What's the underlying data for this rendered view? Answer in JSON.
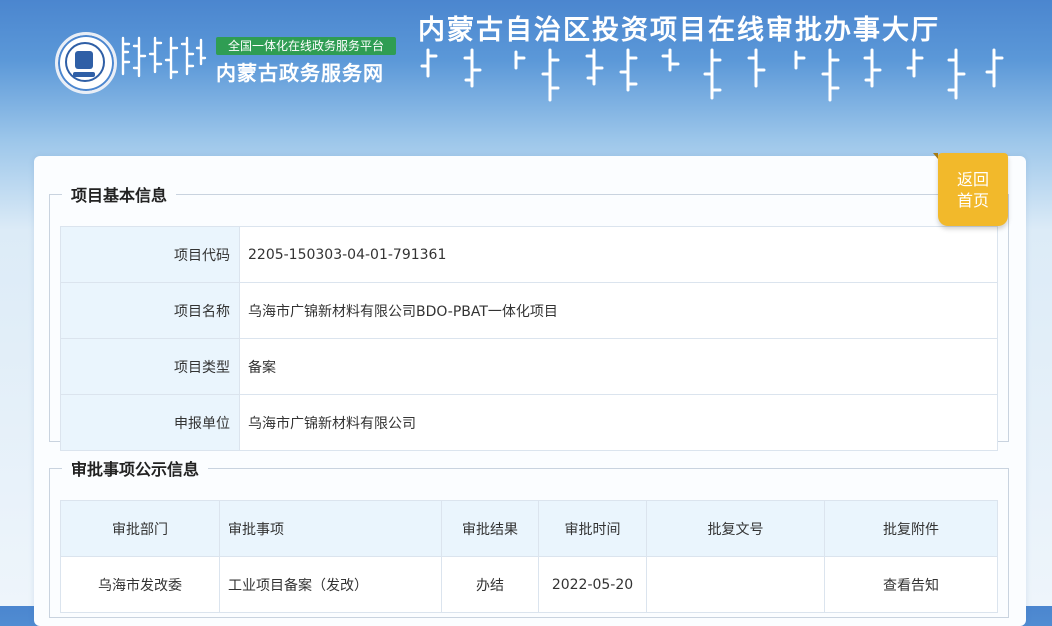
{
  "header": {
    "platform_badge": "全国一体化在线政务服务平台",
    "platform_name": "内蒙古政务服务网",
    "hall_title": "内蒙古自治区投资项目在线审批办事大厅"
  },
  "back_button": {
    "line1": "返回",
    "line2": "首页"
  },
  "basic_info": {
    "title": "项目基本信息",
    "rows": [
      {
        "label": "项目代码",
        "value": "2205-150303-04-01-791361"
      },
      {
        "label": "项目名称",
        "value": "乌海市广锦新材料有限公司BDO-PBAT一体化项目"
      },
      {
        "label": "项目类型",
        "value": "备案"
      },
      {
        "label": "申报单位",
        "value": "乌海市广锦新材料有限公司"
      }
    ]
  },
  "approval_info": {
    "title": "审批事项公示信息",
    "headers": [
      "审批部门",
      "审批事项",
      "审批结果",
      "审批时间",
      "批复文号",
      "批复附件"
    ],
    "rows": [
      {
        "dept": "乌海市发改委",
        "item": "工业项目备案（发改）",
        "result": "办结",
        "date": "2022-05-20",
        "doc_no": "",
        "attachment": "查看告知"
      }
    ]
  },
  "colors": {
    "header_blue": "#4b86cf",
    "badge_green": "#2f9d53",
    "back_button": "#f2b92b",
    "label_bg": "#eaf5fd"
  }
}
